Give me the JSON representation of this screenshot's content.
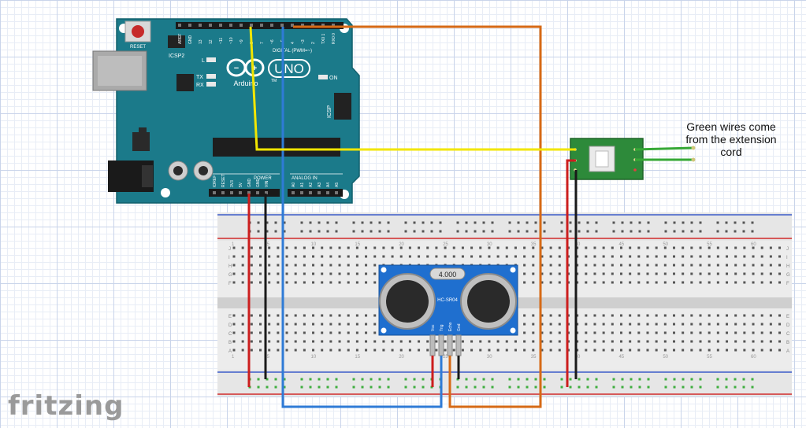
{
  "arduino": {
    "brand": "Arduino",
    "model": "UNO",
    "reset_label": "RESET",
    "icsp2_label": "ICSP2",
    "icsp_label": "ICSP",
    "digital_label": "DIGITAL (PWM=~)",
    "power_label": "POWER",
    "analog_label": "ANALOG IN",
    "led_on": "ON",
    "led_l": "L",
    "led_tx": "TX",
    "led_rx": "RX",
    "trademark": "TM",
    "digital_pins": [
      "AREF",
      "GND",
      "13",
      "12",
      "~11",
      "~10",
      "~9",
      "8",
      "7",
      "~6",
      "~5",
      "4",
      "~3",
      "2",
      "TX0 1",
      "RX0 0"
    ],
    "power_pins": [
      "IOREF",
      "RESET",
      "3V3",
      "5V",
      "GND",
      "GND",
      "VIN"
    ],
    "analog_pins": [
      "A0",
      "A1",
      "A2",
      "A3",
      "A4",
      "A5"
    ]
  },
  "sensor": {
    "model": "HC-SR04",
    "crystal": "4.000",
    "pins": [
      "Vcc",
      "Trig",
      "Echo",
      "Gnd"
    ]
  },
  "breadboard": {
    "row_letters_top": [
      "J",
      "I",
      "H",
      "G",
      "F"
    ],
    "row_letters_bottom": [
      "E",
      "D",
      "C",
      "B",
      "A"
    ],
    "column_numbers": [
      "1",
      "5",
      "10",
      "15",
      "20",
      "25",
      "30",
      "35",
      "40",
      "45",
      "50",
      "55",
      "60"
    ]
  },
  "note": {
    "line1": "Green wires come",
    "line2": "from the extension",
    "line3": "cord"
  },
  "footer": {
    "brand": "fritzing"
  },
  "colors": {
    "board": "#1b7a8a",
    "wire_yellow": "#f2e600",
    "wire_orange": "#d66a16",
    "wire_blue": "#2f7bd6",
    "wire_red": "#cc1e1e",
    "wire_black": "#1a1a1a",
    "wire_green": "#36a836",
    "relay": "#2d8a3a",
    "sensor": "#1f6fcf"
  }
}
